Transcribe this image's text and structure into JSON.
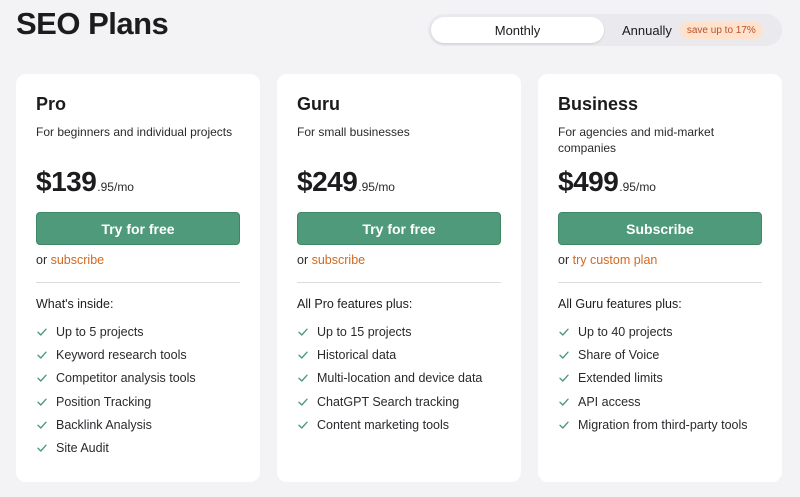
{
  "header": {
    "title": "SEO Plans"
  },
  "billing": {
    "monthly_label": "Monthly",
    "annually_label": "Annually",
    "save_badge": "save up to 17%",
    "selected": "Monthly"
  },
  "colors": {
    "accent": "#4f9a7a",
    "link": "#d2691e",
    "check": "#4f9a7a",
    "badge_bg": "#ffe1cc"
  },
  "plans": [
    {
      "name": "Pro",
      "description": "For beginners and individual projects",
      "price_main": "$139",
      "price_suffix": ".95/mo",
      "cta": "Try for free",
      "alt_prefix": "or",
      "alt_link": "subscribe",
      "features_heading": "What's inside:",
      "features": [
        "Up to 5 projects",
        "Keyword research tools",
        "Competitor analysis tools",
        "Position Tracking",
        "Backlink Analysis",
        "Site Audit"
      ]
    },
    {
      "name": "Guru",
      "description": "For small businesses",
      "price_main": "$249",
      "price_suffix": ".95/mo",
      "cta": "Try for free",
      "alt_prefix": "or",
      "alt_link": "subscribe",
      "features_heading": "All Pro features plus:",
      "features": [
        "Up to 15 projects",
        "Historical data",
        "Multi-location and device data",
        "ChatGPT Search tracking",
        "Content marketing tools"
      ]
    },
    {
      "name": "Business",
      "description": "For agencies and mid-market companies",
      "price_main": "$499",
      "price_suffix": ".95/mo",
      "cta": "Subscribe",
      "alt_prefix": "or",
      "alt_link": "try custom plan",
      "features_heading": "All Guru features plus:",
      "features": [
        "Up to 40 projects",
        "Share of Voice",
        "Extended limits",
        "API access",
        "Migration from third-party tools"
      ]
    }
  ]
}
